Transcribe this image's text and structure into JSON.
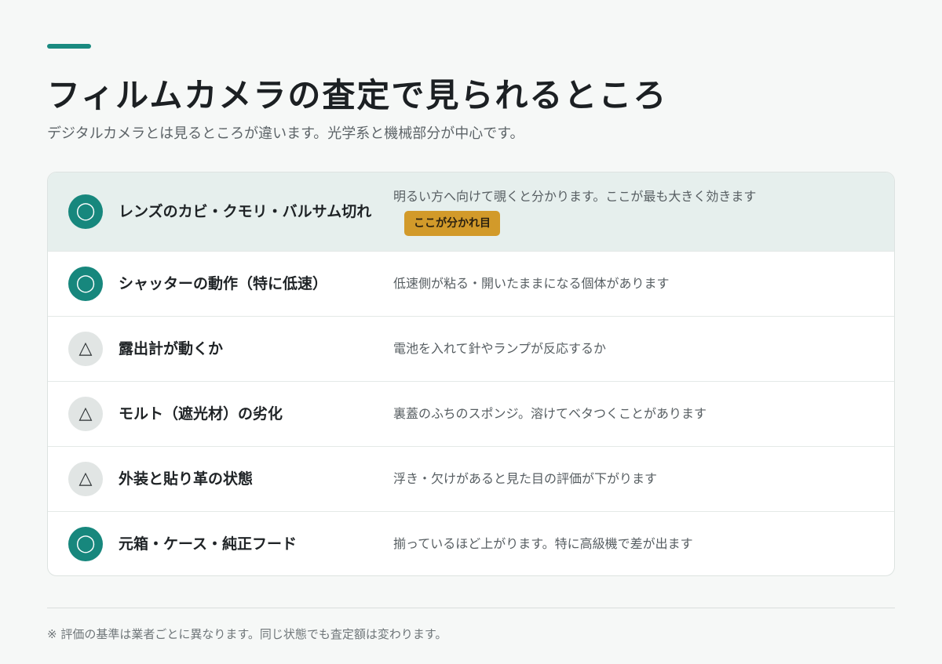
{
  "header": {
    "title": "フィルムカメラの査定で見られるところ",
    "subtitle": "デジタルカメラとは見るところが違います。光学系と機械部分が中心です。"
  },
  "rows": [
    {
      "mark": "◯",
      "label": "レンズのカビ・クモリ・バルサム切れ",
      "description": "明るい方へ向けて覗くと分かります。ここが最も大きく効きます",
      "tag": "ここが分かれ目"
    },
    {
      "mark": "◯",
      "label": "シャッターの動作（特に低速）",
      "description": "低速側が粘る・開いたままになる個体があります"
    },
    {
      "mark": "△",
      "label": "露出計が動くか",
      "description": "電池を入れて針やランプが反応するか"
    },
    {
      "mark": "△",
      "label": "モルト（遮光材）の劣化",
      "description": "裏蓋のふちのスポンジ。溶けてベタつくことがあります"
    },
    {
      "mark": "△",
      "label": "外装と貼り革の状態",
      "description": "浮き・欠けがあると見た目の評価が下がります"
    },
    {
      "mark": "◯",
      "label": "元箱・ケース・純正フード",
      "description": "揃っているほど上がります。特に高級機で差が出ます"
    }
  ],
  "footer": {
    "note": "※ 評価の基準は業者ごとに異なります。同じ状態でも査定額は変わります。"
  },
  "colors": {
    "accent": "#1a8a80",
    "good_badge": "#17877d",
    "fair_badge": "#e1e5e4",
    "highlight_row": "#e6efed",
    "key_tag": "#d29a2a"
  }
}
